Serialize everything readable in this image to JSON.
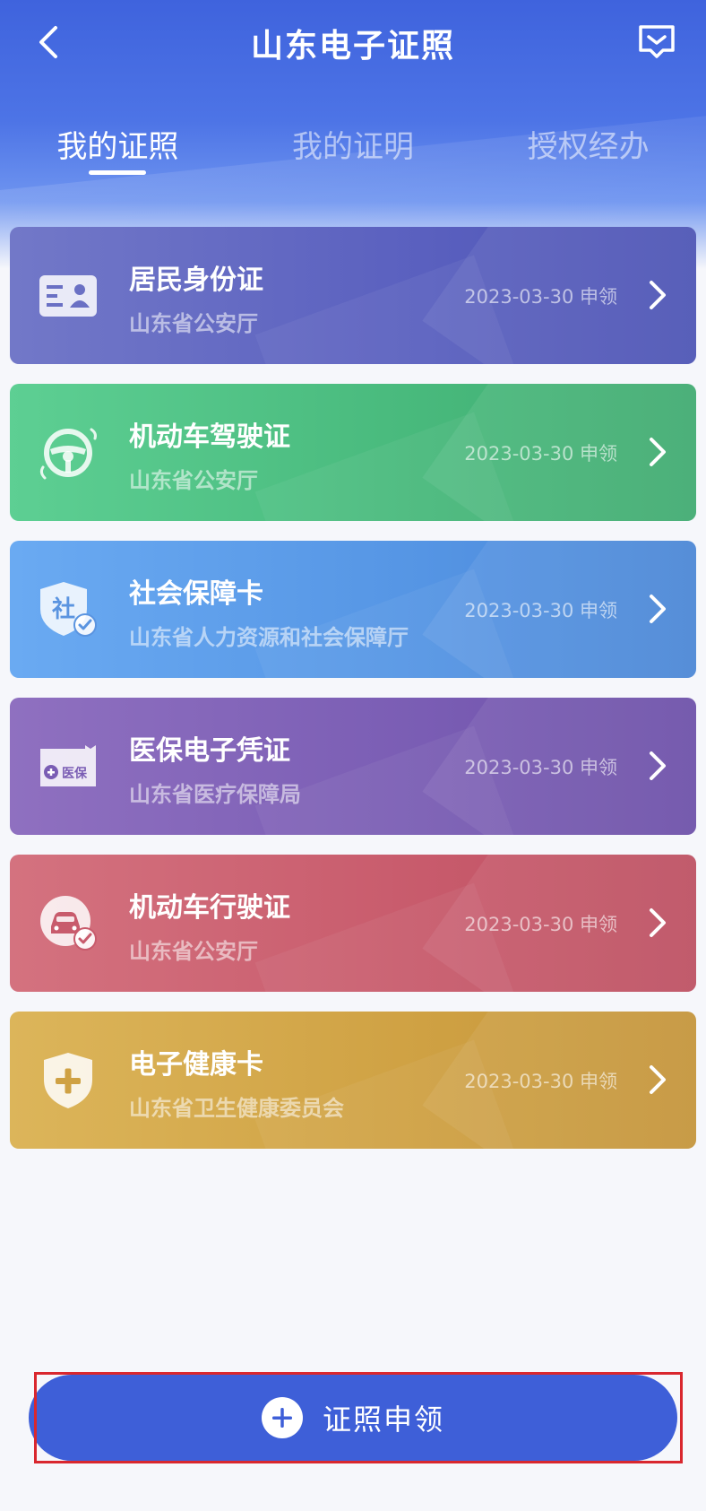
{
  "header": {
    "title": "山东电子证照",
    "back_icon": "chevron-left-icon",
    "message_icon": "message-icon"
  },
  "tabs": [
    {
      "label": "我的证照",
      "active": true
    },
    {
      "label": "我的证明",
      "active": false
    },
    {
      "label": "授权经办",
      "active": false
    }
  ],
  "cards": [
    {
      "name": "居民身份证",
      "issuer": "山东省公安厅",
      "date": "2023-03-30 申领",
      "icon": "id-card-icon",
      "color": "#5a60bf"
    },
    {
      "name": "机动车驾驶证",
      "issuer": "山东省公安厅",
      "date": "2023-03-30 申领",
      "icon": "steering-wheel-icon",
      "color": "#48b97c"
    },
    {
      "name": "社会保障卡",
      "issuer": "山东省人力资源和社会保障厅",
      "date": "2023-03-30 申领",
      "icon": "social-security-shield-icon",
      "icon_text": "社",
      "color": "#5595e4"
    },
    {
      "name": "医保电子凭证",
      "issuer": "山东省医疗保障局",
      "date": "2023-03-30 申领",
      "icon": "medical-insurance-icon",
      "icon_text": "医保",
      "color": "#7a5db4"
    },
    {
      "name": "机动车行驶证",
      "issuer": "山东省公安厅",
      "date": "2023-03-30 申领",
      "icon": "car-icon",
      "color": "#c85b6c"
    },
    {
      "name": "电子健康卡",
      "issuer": "山东省卫生健康委员会",
      "date": "2023-03-30 申领",
      "icon": "health-shield-icon",
      "color": "#cfa143"
    }
  ],
  "apply_button": {
    "label": "证照申领",
    "icon": "plus-circle-icon",
    "color": "#3e5fd8"
  }
}
